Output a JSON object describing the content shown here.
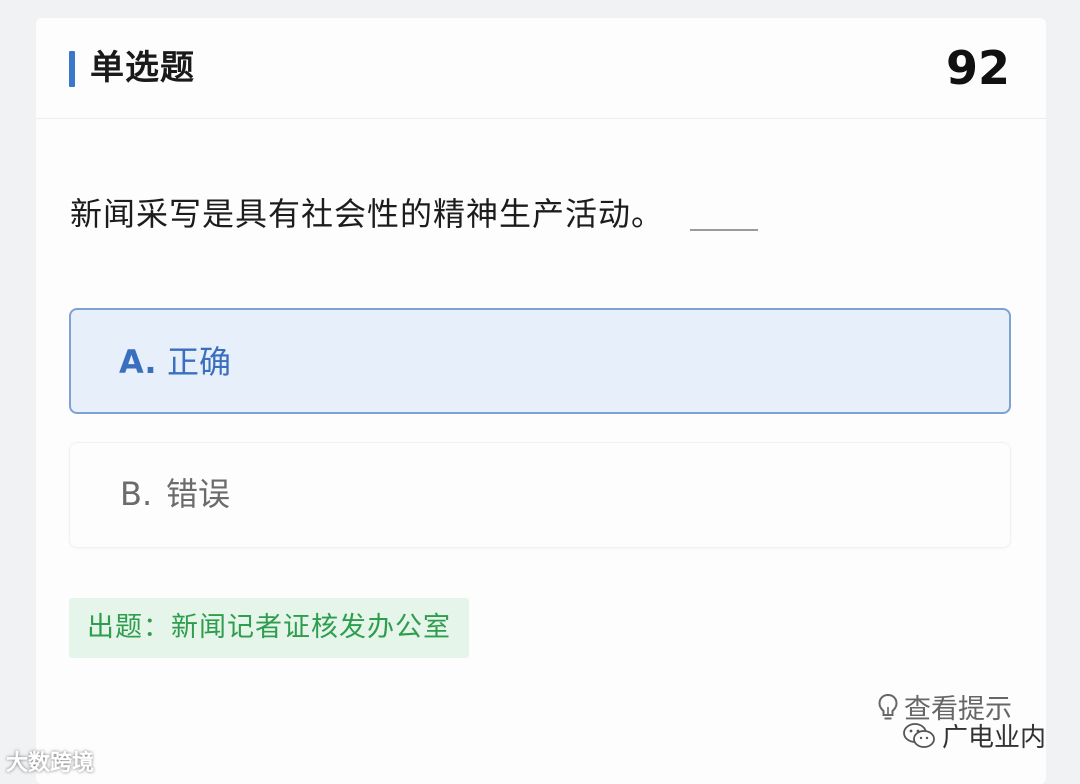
{
  "header": {
    "title": "单选题",
    "number": "92",
    "accent_color": "#3b78c9"
  },
  "question": {
    "text": "新闻采写是具有社会性的精神生产活动。"
  },
  "options": [
    {
      "letter": "A.",
      "text": "正确",
      "selected": true
    },
    {
      "letter": "B.",
      "text": "错误",
      "selected": false
    }
  ],
  "source": {
    "text": "出题：新闻记者证核发办公室",
    "color": "#2f9d4e"
  },
  "hint": {
    "icon": "lightbulb-icon",
    "label": "查看提示"
  },
  "watermarks": {
    "left": "大数跨境",
    "right": "广电业内",
    "right_icon": "wechat-icon"
  }
}
